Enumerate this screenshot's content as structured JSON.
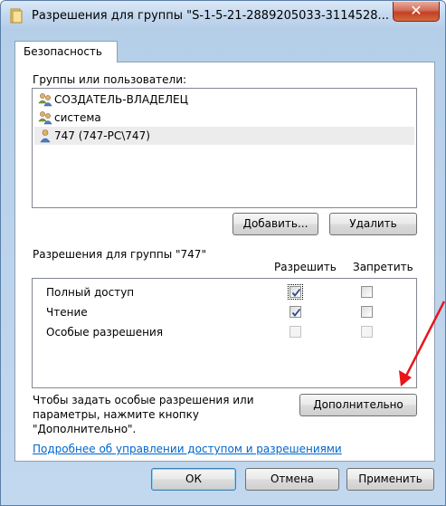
{
  "window": {
    "title": "Разрешения для группы \"S-1-5-21-2889205033-3114528...",
    "close_glyph": "✕"
  },
  "tabs": [
    {
      "label": "Безопасность",
      "selected": true
    }
  ],
  "groups": {
    "label": "Группы или пользователи:",
    "items": [
      {
        "name": "СОЗДАТЕЛЬ-ВЛАДЕЛЕЦ",
        "icon": "users-icon"
      },
      {
        "name": "система",
        "icon": "users-icon"
      },
      {
        "name": "747 (747-PC\\747)",
        "icon": "user-icon",
        "selected": true
      }
    ],
    "add_label": "Добавить...",
    "remove_label": "Удалить"
  },
  "permissions": {
    "label": "Разрешения для группы \"747\"",
    "allow_header": "Разрешить",
    "deny_header": "Запретить",
    "rows": [
      {
        "name": "Полный доступ",
        "allow": true,
        "deny": false,
        "enabled": true
      },
      {
        "name": "Чтение",
        "allow": true,
        "deny": false,
        "enabled": true
      },
      {
        "name": "Особые разрешения",
        "allow": false,
        "deny": false,
        "enabled": false
      }
    ]
  },
  "advanced": {
    "hint": [
      "Чтобы задать особые разрешения или",
      "параметры, нажмите кнопку",
      "\"Дополнительно\"."
    ],
    "button_label": "Дополнительно"
  },
  "link_text": "Подробнее об управлении доступом и разрешениями",
  "footer": {
    "ok_label": "ОК",
    "cancel_label": "Отмена",
    "apply_label": "Применить"
  },
  "colors": {
    "annotation_arrow": "#e8151b",
    "link": "#0066cc"
  }
}
